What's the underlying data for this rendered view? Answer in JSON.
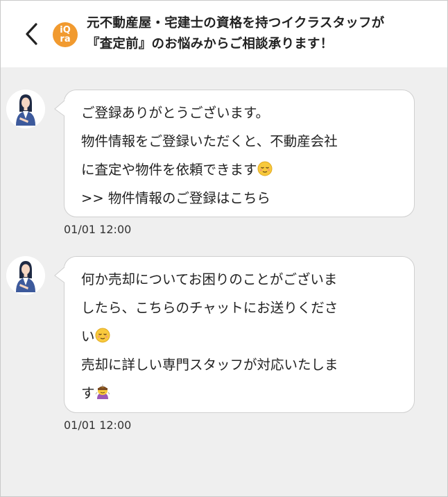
{
  "header": {
    "logo_top": "iQ",
    "logo_bottom": "ra",
    "title_line1": "元不動産屋・宅建士の資格を持つイクラスタッフが",
    "title_line2": "『査定前』のお悩みからご相談承ります！"
  },
  "messages": [
    {
      "lines": [
        "ご登録ありがとうございます。",
        "物件情報をご登録いただくと、不動産会社",
        "に査定や物件を依頼できます",
        ">> 物件情報のご登録はこちら"
      ],
      "time": "01/01 12:00"
    },
    {
      "lines": [
        "何か売却についてお困りのことがございま",
        "したら、こちらのチャットにお送りくださ",
        "い",
        "売却に詳しい専門スタッフが対応いたしま",
        "す"
      ],
      "time": "01/01 12:00"
    }
  ],
  "colors": {
    "logo": "#f19a2f",
    "chat_background": "#efefef",
    "bubble": "#ffffff",
    "bubble_border": "#cfcfcf"
  },
  "icons": {
    "back": "chevron-left-icon",
    "relieved": "relieved-face-emoji",
    "bowing": "bowing-woman-emoji"
  }
}
